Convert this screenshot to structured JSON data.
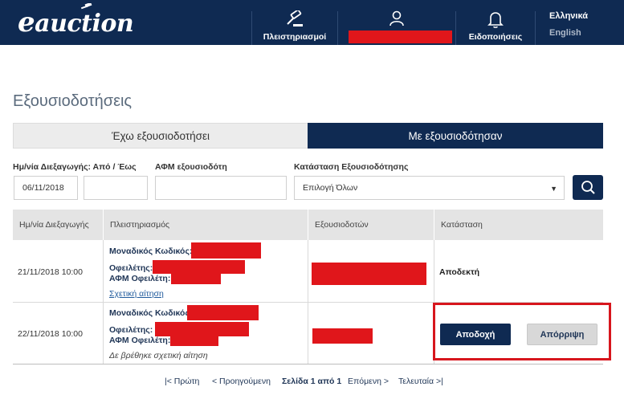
{
  "header": {
    "logo_text": "auction",
    "logo_e": "e",
    "nav": [
      {
        "label": "Πλειστηριασμοί",
        "icon": "gavel-icon"
      },
      {
        "label": "",
        "icon": "user-icon"
      },
      {
        "label": "Ειδοποιήσεις",
        "icon": "bell-icon"
      }
    ],
    "languages": [
      "Ελληνικά",
      "English"
    ]
  },
  "page": {
    "title": "Εξουσιοδοτήσεις"
  },
  "tabs": [
    {
      "label": "Έχω εξουσιοδοτήσει",
      "active": false
    },
    {
      "label": "Με εξουσιοδότησαν",
      "active": true
    }
  ],
  "filters": {
    "date_label": "Ημ/νία Διεξαγωγής: Από / Έως",
    "date_from": "06/11/2018",
    "date_to": "",
    "afm_label": "ΑΦΜ εξουσιοδότη",
    "afm_value": "",
    "status_label": "Κατάσταση Εξουσιοδότησης",
    "status_value": "Επιλογή Όλων"
  },
  "table": {
    "headers": [
      "Ημ/νία Διεξαγωγής",
      "Πλειστηριασμός",
      "Εξουσιοδοτών",
      "Κατάσταση"
    ],
    "rows": [
      {
        "date": "21/11/2018 10:00",
        "code_label": "Μοναδικός Κωδικός:",
        "debtor_label": "Οφειλέτης:",
        "afm_label": "ΑΦΜ Οφειλέτη:",
        "request": "Σχετική αίτηση",
        "status": "Αποδεκτή"
      },
      {
        "date": "22/11/2018 10:00",
        "code_label": "Μοναδικός Κωδικός:",
        "debtor_label": "Οφειλέτης:",
        "afm_label": "ΑΦΜ Οφειλέτη:",
        "request": "Δε βρέθηκε σχετική αίτηση",
        "accept": "Αποδοχή",
        "reject": "Απόρριψη"
      }
    ]
  },
  "pagination": {
    "first": "|< Πρώτη",
    "prev": "< Προηγούμενη",
    "current": "Σελίδα 1 από 1",
    "next": "Επόμενη >",
    "last": "Τελευταία >|"
  },
  "colors": {
    "navy": "#0f2a52",
    "redaction": "#e0161b",
    "highlight": "#d7161d"
  }
}
